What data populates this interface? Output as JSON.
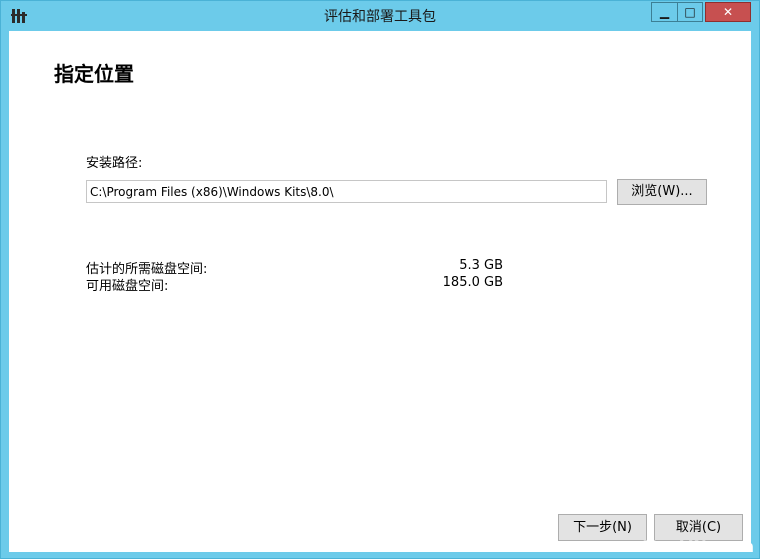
{
  "window": {
    "title": "评估和部署工具包",
    "min_glyph": "▁",
    "max_glyph": "□",
    "close_glyph": "✕"
  },
  "page": {
    "heading": "指定位置"
  },
  "install": {
    "path_label": "安装路径:",
    "path_value": "C:\\Program Files (x86)\\Windows Kits\\8.0\\",
    "browse_label": "浏览(W)..."
  },
  "space": {
    "estimated_label": "估计的所需磁盘空间:",
    "estimated_value": "5.3 GB",
    "available_label": "可用磁盘空间:",
    "available_value": "185.0 GB"
  },
  "footer": {
    "next_label": "下一步(N)",
    "cancel_label": "取消(C)"
  },
  "watermark": "YunVN.com",
  "colors": {
    "frame": "#6ccbea",
    "close_button": "#c75050"
  }
}
